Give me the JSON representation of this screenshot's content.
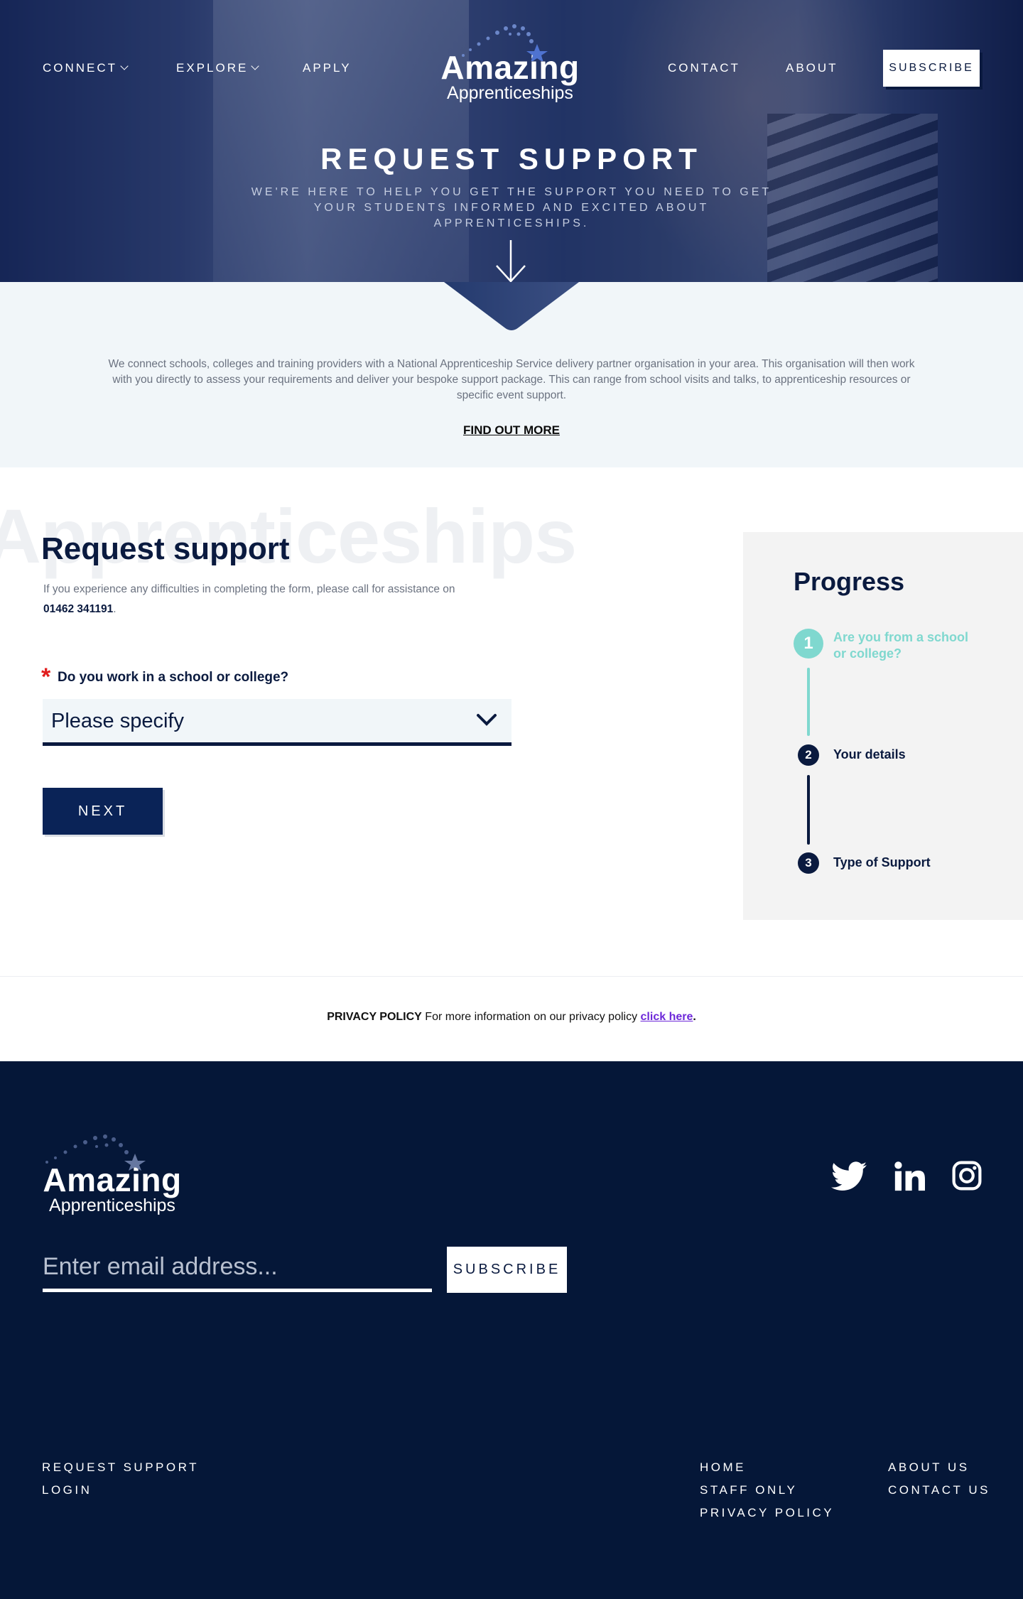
{
  "header": {
    "nav_left": [
      {
        "label": "CONNECT",
        "has_dropdown": true
      },
      {
        "label": "EXPLORE",
        "has_dropdown": true
      },
      {
        "label": "APPLY",
        "has_dropdown": false
      }
    ],
    "nav_right": [
      {
        "label": "CONTACT"
      },
      {
        "label": "ABOUT"
      }
    ],
    "subscribe_label": "SUBSCRIBE",
    "logo": {
      "brand": "Amazing",
      "sub": "Apprenticeships"
    }
  },
  "hero": {
    "title": "REQUEST SUPPORT",
    "subtitle": "WE'RE HERE TO HELP YOU GET THE SUPPORT YOU NEED TO GET YOUR STUDENTS INFORMED AND EXCITED ABOUT APPRENTICESHIPS."
  },
  "intro": {
    "text": "We connect schools, colleges and training providers with a National Apprenticeship Service delivery partner organisation in your area. This organisation will then work with you directly to assess your requirements and deliver your bespoke support package. This can range from school visits and talks, to apprenticeship resources or specific event support.",
    "link": "FIND OUT MORE"
  },
  "form": {
    "watermark": "Apprenticeships",
    "title": "Request support",
    "help_text": "If you experience any difficulties in completing the form, please call for assistance on",
    "phone": "01462 341191",
    "help_end": ".",
    "required_marker": "*",
    "question": "Do you work in a school or college?",
    "select_value": "Please specify",
    "next_label": "NEXT"
  },
  "progress": {
    "title": "Progress",
    "steps": [
      {
        "number": "1",
        "label": "Are you from a school or college?",
        "active": true
      },
      {
        "number": "2",
        "label": "Your details",
        "active": false
      },
      {
        "number": "3",
        "label": "Type of Support",
        "active": false
      }
    ]
  },
  "privacy": {
    "heading": "PRIVACY POLICY",
    "text": "For more information on our privacy policy",
    "link": "click here",
    "end": "."
  },
  "footer": {
    "logo": {
      "brand": "Amazing",
      "sub": "Apprenticeships"
    },
    "email_placeholder": "Enter email address...",
    "subscribe_label": "SUBSCRIBE",
    "social": [
      "twitter-icon",
      "linkedin-icon",
      "instagram-icon"
    ],
    "links_left": [
      "REQUEST SUPPORT",
      "LOGIN"
    ],
    "links_mid": [
      "HOME",
      "STAFF ONLY",
      "PRIVACY POLICY"
    ],
    "links_right": [
      "ABOUT US",
      "CONTACT US"
    ]
  },
  "colors": {
    "navy": "#0a1a3f",
    "footer_bg": "#051738",
    "teal": "#7fd8cf",
    "button": "#0a2357",
    "required": "#e11d1d",
    "link_purple": "#6d28d9"
  }
}
